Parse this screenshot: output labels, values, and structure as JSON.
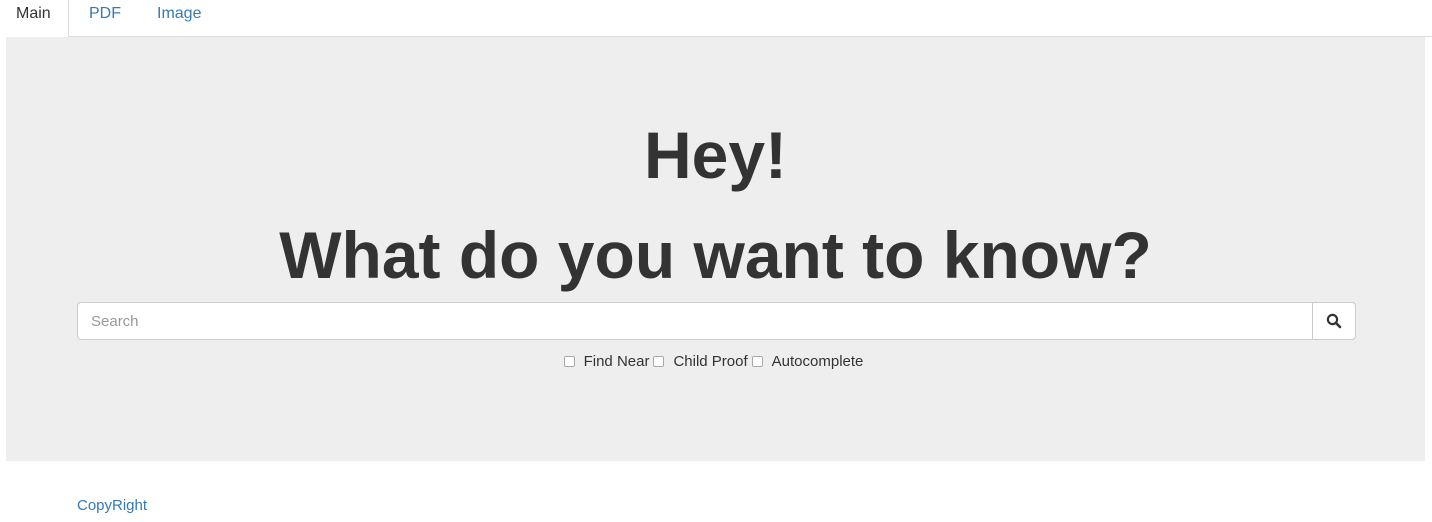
{
  "tabs": [
    {
      "label": "Main",
      "active": true
    },
    {
      "label": "PDF",
      "active": false
    },
    {
      "label": "Image",
      "active": false
    }
  ],
  "hero": {
    "greeting": "Hey!",
    "question": "What do you want to know?"
  },
  "search": {
    "placeholder": "Search",
    "value": "",
    "button_icon": "search-icon"
  },
  "options": [
    {
      "label": "Find Near",
      "checked": false
    },
    {
      "label": "Child Proof",
      "checked": false
    },
    {
      "label": "Autocomplete",
      "checked": false
    }
  ],
  "footer": {
    "copyright": "CopyRight"
  },
  "colors": {
    "link": "#337ab7",
    "jumbotron_bg": "#eeeeee",
    "text": "#333333"
  }
}
